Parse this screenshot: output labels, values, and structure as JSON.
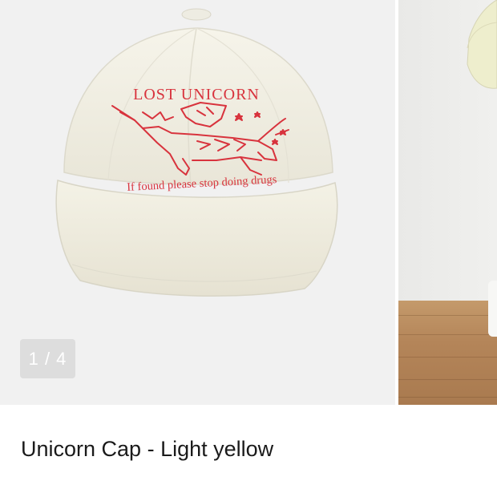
{
  "carousel": {
    "counter": "1 / 4",
    "current_index": 1,
    "total": 4
  },
  "product": {
    "title": "Unicorn Cap - Light yellow",
    "embroidery_top": "LOST UNICORN",
    "embroidery_bottom": "If found please stop doing drugs"
  },
  "colors": {
    "cap": "#f3f1e6",
    "embroidery": "#d8333d",
    "counter_bg": "#dddddd",
    "floor": "#b48559"
  }
}
